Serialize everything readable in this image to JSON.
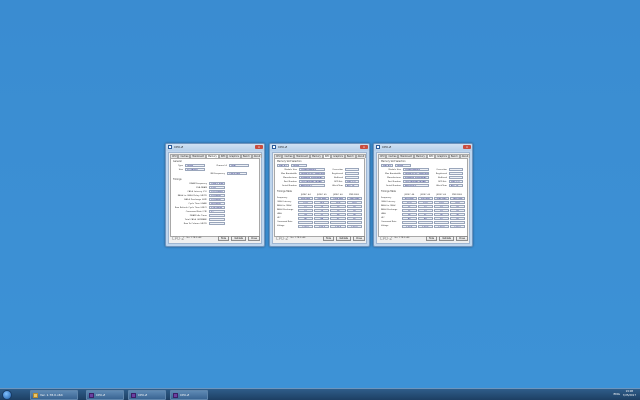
{
  "app": {
    "name": "CPU-Z",
    "version": "Ver. 1.78.0.x64"
  },
  "tabs": [
    "CPU",
    "Caches",
    "Mainboard",
    "Memory",
    "SPD",
    "Graphics",
    "Bench",
    "About"
  ],
  "footer": {
    "tools": "Tools",
    "validate": "Validate",
    "close": "Close"
  },
  "memory_window": {
    "general_label": "General",
    "timings_label": "Timings",
    "rows_general": [
      {
        "label": "Type",
        "value": "DDR4"
      },
      {
        "label": "Size",
        "value": "32 GBytes"
      },
      {
        "label": "Channel #",
        "value": "Dual"
      },
      {
        "label": "NB Frequency",
        "value": "798.8 MHz"
      }
    ],
    "rows_timings": [
      {
        "label": "DRAM Frequency",
        "value": "1066.2 MHz"
      },
      {
        "label": "FSB:DRAM",
        "value": "1:16"
      },
      {
        "label": "CAS# Latency (CL)",
        "value": "15.0 clocks"
      },
      {
        "label": "RAS# to CAS# Delay (tRCD)",
        "value": "15 clocks"
      },
      {
        "label": "RAS# Precharge (tRP)",
        "value": "15 clocks"
      },
      {
        "label": "Cycle Time (tRAS)",
        "value": "36 clocks"
      },
      {
        "label": "Row Refresh Cycle Time (tRFC)",
        "value": "278 clocks"
      },
      {
        "label": "Command Rate (CR)",
        "value": "2T"
      },
      {
        "label": "DRAM Idle Timer",
        "value": ""
      },
      {
        "label": "Total CAS# (tRDRAM)",
        "value": ""
      },
      {
        "label": "Row To Column (tRCD)",
        "value": ""
      }
    ]
  },
  "spd_windows": [
    {
      "slot_title": "Memory Slot Selection",
      "slot": "Slot #1",
      "slot_type": "DDR4",
      "rows": [
        {
          "label": "Module Size",
          "value": "16384 MBytes"
        },
        {
          "label": "Max Bandwidth",
          "value": "DDR4-2132 (1066 MHz)"
        },
        {
          "label": "Manufacturer",
          "value": "Kingston Technology"
        },
        {
          "label": "Part Number",
          "value": "TB1,2400H8-16GBB"
        },
        {
          "label": "Serial Number",
          "value": "B4D7D3C1"
        }
      ],
      "side": [
        {
          "label": "Correction",
          "value": ""
        },
        {
          "label": "Registered",
          "value": ""
        },
        {
          "label": "Buffered",
          "value": ""
        },
        {
          "label": "SPD Ext.",
          "value": "XMP 2.0"
        },
        {
          "label": "Week/Year",
          "value": "46 / 15"
        }
      ],
      "timings_title": "Timings Table",
      "columns": [
        "JEDEC #4",
        "JEDEC #5",
        "JEDEC #6",
        "XMP-2800"
      ],
      "table": [
        {
          "label": "Frequency",
          "cells": [
            "824 MHz",
            "900 MHz",
            "1066 MHz",
            "1400 MHz"
          ]
        },
        {
          "label": "CAS# Latency",
          "cells": [
            "12.0",
            "13.0",
            "15.0",
            "16.0"
          ]
        },
        {
          "label": "RAS# to CAS#",
          "cells": [
            "12",
            "13",
            "15",
            "16"
          ]
        },
        {
          "label": "RAS# Precharge",
          "cells": [
            "12",
            "13",
            "15",
            "16"
          ]
        },
        {
          "label": "tRAS",
          "cells": [
            "28",
            "31",
            "36",
            "36"
          ]
        },
        {
          "label": "tRC",
          "cells": [
            "40",
            "44",
            "51",
            "52"
          ]
        },
        {
          "label": "Command Rate",
          "cells": [
            "",
            "",
            "",
            ""
          ]
        },
        {
          "label": "Voltage",
          "cells": [
            "1.20 V",
            "1.20 V",
            "1.20 V",
            "1.20 V"
          ]
        }
      ]
    },
    {
      "slot_title": "Memory Slot Selection",
      "slot": "Slot #3",
      "slot_type": "DDR4",
      "rows": [
        {
          "label": "Module Size",
          "value": "16384 MBytes"
        },
        {
          "label": "Max Bandwidth",
          "value": "DDR4-2132 (1066 MHz)"
        },
        {
          "label": "Manufacturer",
          "value": "Kingston Technology"
        },
        {
          "label": "Part Number",
          "value": "TB1,2400H8-16GBB"
        },
        {
          "label": "Serial Number",
          "value": "B4D7D3C2"
        }
      ],
      "side": [
        {
          "label": "Correction",
          "value": ""
        },
        {
          "label": "Registered",
          "value": ""
        },
        {
          "label": "Buffered",
          "value": ""
        },
        {
          "label": "SPD Ext.",
          "value": "XMP 2.0"
        },
        {
          "label": "Week/Year",
          "value": "46 / 15"
        }
      ],
      "timings_title": "Timings Table",
      "columns": [
        "JEDEC #4",
        "JEDEC #5",
        "JEDEC #6",
        "XMP-2800"
      ],
      "table": [
        {
          "label": "Frequency",
          "cells": [
            "824 MHz",
            "900 MHz",
            "1066 MHz",
            "1400 MHz"
          ]
        },
        {
          "label": "CAS# Latency",
          "cells": [
            "12.0",
            "13.0",
            "15.0",
            "16.0"
          ]
        },
        {
          "label": "RAS# to CAS#",
          "cells": [
            "12",
            "13",
            "15",
            "16"
          ]
        },
        {
          "label": "RAS# Precharge",
          "cells": [
            "12",
            "13",
            "15",
            "16"
          ]
        },
        {
          "label": "tRAS",
          "cells": [
            "28",
            "31",
            "36",
            "36"
          ]
        },
        {
          "label": "tRC",
          "cells": [
            "40",
            "44",
            "51",
            "52"
          ]
        },
        {
          "label": "Command Rate",
          "cells": [
            "",
            "",
            "",
            ""
          ]
        },
        {
          "label": "Voltage",
          "cells": [
            "1.20 V",
            "1.20 V",
            "1.20 V",
            "1.20 V"
          ]
        }
      ]
    }
  ],
  "taskbar": {
    "items": [
      {
        "label": "Ver. 1.78.0.x64",
        "icon": "folder-icon"
      },
      {
        "label": "CPU-Z",
        "icon": "cpuz-icon"
      },
      {
        "label": "CPU-Z",
        "icon": "cpuz-icon"
      },
      {
        "label": "CPU-Z",
        "icon": "cpuz-icon"
      }
    ],
    "tray": "ENG",
    "time": "19:08",
    "date": "7/25/2017"
  },
  "colors": {
    "desktop": "#3b8ed3",
    "taskbar": "#1d3f63",
    "value_text": "#1a1a80"
  }
}
